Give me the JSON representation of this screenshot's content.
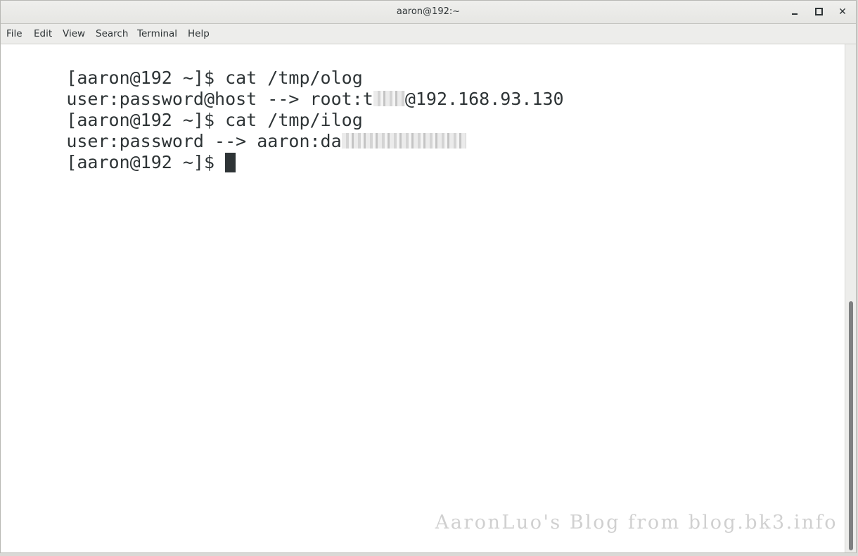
{
  "window": {
    "title": "aaron@192:~"
  },
  "titlebar_buttons": {
    "minimize": "minimize-icon",
    "maximize": "maximize-icon",
    "close": "close-icon",
    "close_glyph": "✕"
  },
  "menubar": {
    "items": [
      "File",
      "Edit",
      "View",
      "Search",
      "Terminal",
      "Help"
    ]
  },
  "terminal": {
    "lines": [
      {
        "text": "[aaron@192 ~]$ cat /tmp/olog"
      },
      {
        "prefix": "user:password@host --> root:t",
        "suffix": "@192.168.93.130"
      },
      {
        "text": "[aaron@192 ~]$ cat /tmp/ilog"
      },
      {
        "prefix": "user:password --> aaron:da",
        "suffix": ""
      },
      {
        "prompt": "[aaron@192 ~]$ "
      }
    ]
  },
  "watermark": "AaronLuo's Blog from blog.bk3.info",
  "colors": {
    "terminal_bg": "#ffffff",
    "terminal_fg": "#2e3436",
    "titlebar_bg": "#e6e6e3",
    "scroll_thumb": "#7e8081"
  }
}
